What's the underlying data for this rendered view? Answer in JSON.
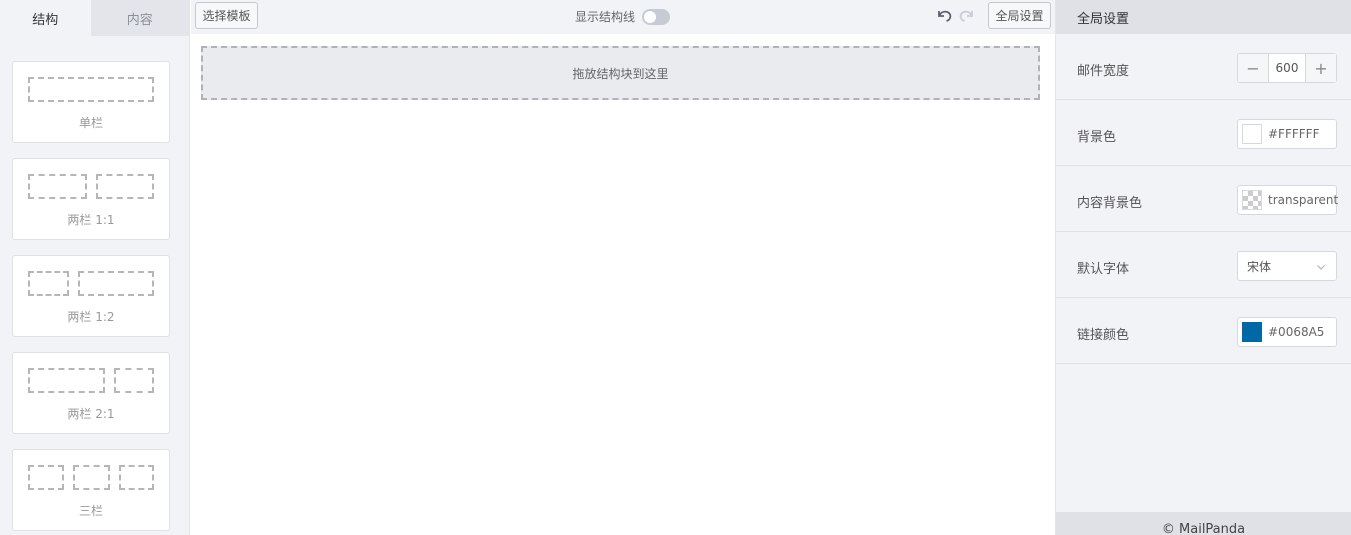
{
  "left_panel": {
    "tabs": [
      {
        "label": "结构"
      },
      {
        "label": "内容"
      }
    ],
    "blocks": [
      {
        "label": "单栏"
      },
      {
        "label": "两栏 1:1"
      },
      {
        "label": "两栏 1:2"
      },
      {
        "label": "两栏 2:1"
      },
      {
        "label": "三栏"
      }
    ]
  },
  "toolbar": {
    "template_label": "选择模板",
    "show_structure_label": "显示结构线",
    "show_structure_enabled": false,
    "global_settings_label": "全局设置"
  },
  "canvas": {
    "dropzone_label": "拖放结构块到这里"
  },
  "right_panel": {
    "title": "全局设置",
    "fields": {
      "width": {
        "label": "邮件宽度",
        "value": "600",
        "minus": "−",
        "plus": "+"
      },
      "background": {
        "label": "背景色",
        "value": "#FFFFFF",
        "color": "#FFFFFF"
      },
      "content_background": {
        "label": "内容背景色",
        "value": "transparent"
      },
      "font": {
        "label": "默认字体",
        "value": "宋体"
      },
      "link_color": {
        "label": "链接颜色",
        "value": "#0068A5",
        "color": "#0068A5"
      }
    },
    "footer": "© MailPanda"
  }
}
